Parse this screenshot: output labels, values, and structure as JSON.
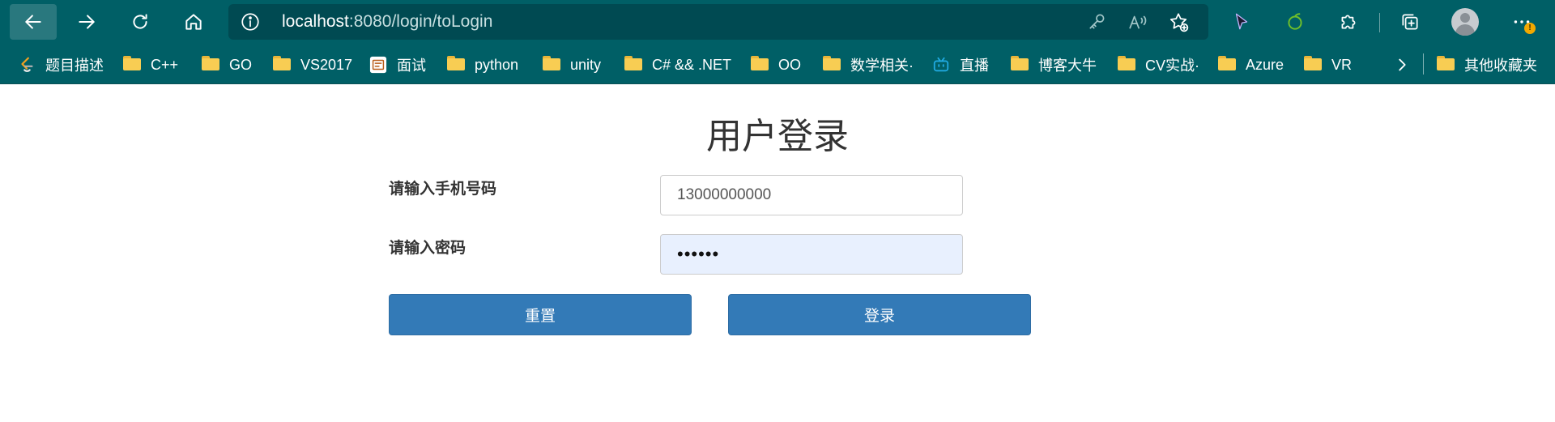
{
  "browser": {
    "url_host": "localhost",
    "url_path": ":8080/login/toLogin",
    "alert_badge": "!"
  },
  "bookmarks": {
    "items": [
      {
        "label": "题目描述",
        "icon": "leetcode-icon"
      },
      {
        "label": "C++",
        "icon": "folder-icon"
      },
      {
        "label": "GO",
        "icon": "folder-icon"
      },
      {
        "label": "VS2017",
        "icon": "folder-icon"
      },
      {
        "label": "面试",
        "icon": "site-icon"
      },
      {
        "label": "python",
        "icon": "folder-icon"
      },
      {
        "label": "unity",
        "icon": "folder-icon"
      },
      {
        "label": "C# && .NET",
        "icon": "folder-icon"
      },
      {
        "label": "OO",
        "icon": "folder-icon"
      },
      {
        "label": "数学相关·",
        "icon": "folder-icon"
      },
      {
        "label": "直播",
        "icon": "bilibili-icon"
      },
      {
        "label": "博客大牛",
        "icon": "folder-icon"
      },
      {
        "label": "CV实战·",
        "icon": "folder-icon"
      },
      {
        "label": "Azure",
        "icon": "folder-icon"
      },
      {
        "label": "VR",
        "icon": "folder-icon"
      }
    ],
    "other_label": "其他收藏夹"
  },
  "login": {
    "title": "用户登录",
    "phone_label": "请输入手机号码",
    "phone_value": "13000000000",
    "password_label": "请输入密码",
    "password_value": "••••••",
    "reset_label": "重置",
    "submit_label": "登录"
  },
  "colors": {
    "browser_chrome": "#005f66",
    "address_bar": "#004a52",
    "button_primary": "#337ab7",
    "autofill_bg": "#e8f0fe",
    "folder": "#f8cd53"
  }
}
